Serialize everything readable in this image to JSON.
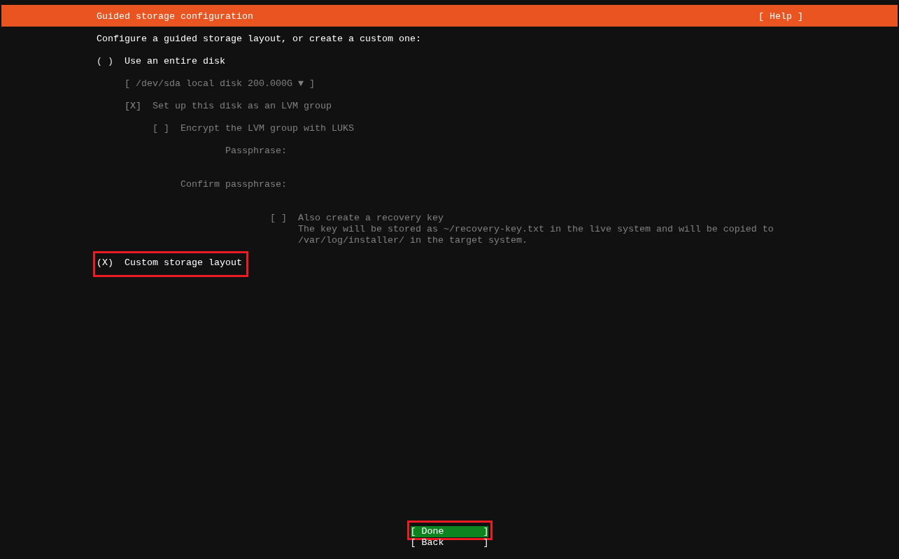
{
  "header": {
    "title": "Guided storage configuration",
    "help": "[ Help ]"
  },
  "intro": "Configure a guided storage layout, or create a custom one:",
  "options": [
    {
      "kind": "radio",
      "mark": "( )",
      "label": "Use an entire disk",
      "selected": false,
      "disabled": false,
      "highlighted": false,
      "children": [
        {
          "kind": "dropdown",
          "value": "[ /dev/sda local disk 200.000G ▼ ]",
          "disabled": true
        },
        {
          "kind": "checkbox",
          "mark": "[X]",
          "label": "Set up this disk as an LVM group",
          "checked": true,
          "disabled": true,
          "children": [
            {
              "kind": "checkbox",
              "mark": "[ ]",
              "label": "Encrypt the LVM group with LUKS",
              "checked": false,
              "disabled": true,
              "children": [
                {
                  "kind": "password",
                  "label": "Passphrase:",
                  "disabled": true
                },
                {
                  "kind": "password",
                  "label": "Confirm passphrase:",
                  "disabled": true
                },
                {
                  "kind": "fieldcheckbox",
                  "mark": "[ ]",
                  "label": "Also create a recovery key",
                  "checked": false,
                  "disabled": true,
                  "help": "The key will be stored as ~/recovery-key.txt in the live system and will be copied to /var/log/installer/ in the target system."
                }
              ]
            }
          ]
        }
      ]
    },
    {
      "kind": "radio",
      "mark": "(X)",
      "label": "Custom storage layout",
      "selected": true,
      "disabled": false,
      "highlighted": true
    }
  ],
  "buttons": [
    {
      "label": "[ Done       ]",
      "focused": true,
      "highlighted": true
    },
    {
      "label": "[ Back       ]",
      "focused": false,
      "highlighted": false
    }
  ]
}
